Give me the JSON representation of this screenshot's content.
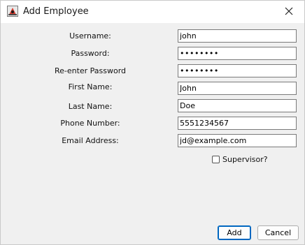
{
  "window": {
    "title": "Add Employee",
    "app_icon": "java-duke-icon",
    "close_icon": "close-icon"
  },
  "form": {
    "username": {
      "label": "Username:",
      "value": "john"
    },
    "password": {
      "label": "Password:",
      "value": "••••••••"
    },
    "reenter_password": {
      "label": "Re-enter Password",
      "value": "••••••••"
    },
    "first_name": {
      "label": "First Name:",
      "value": "John"
    },
    "last_name": {
      "label": "Last Name:",
      "value": "Doe"
    },
    "phone": {
      "label": "Phone Number:",
      "value": "5551234567"
    },
    "email": {
      "label": "Email Address:",
      "value": "jd@example.com"
    },
    "supervisor": {
      "label": "Supervisor?",
      "checked": false
    }
  },
  "buttons": {
    "add_label": "Add",
    "cancel_label": "Cancel"
  },
  "colors": {
    "background": "#f0f0f0",
    "titlebar": "#ffffff",
    "accent": "#0067c0"
  }
}
